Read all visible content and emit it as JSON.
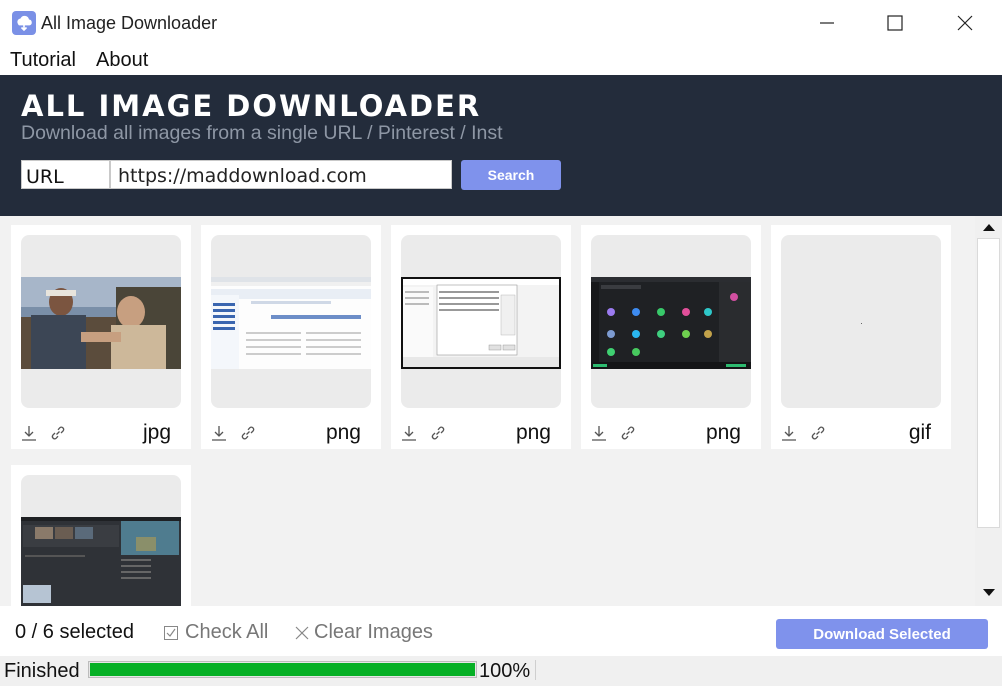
{
  "window": {
    "title": "All Image Downloader"
  },
  "menu": {
    "tutorial": "Tutorial",
    "about": "About"
  },
  "banner": {
    "title": "ALL IMAGE DOWNLOADER",
    "subtitle": "Download all images from a single URL / Pinterest / Inst"
  },
  "search": {
    "type_value": "URL",
    "url_value": "https://maddownload.com",
    "button_label": "Search"
  },
  "images": [
    {
      "ext": "jpg",
      "kind": "photo"
    },
    {
      "ext": "png",
      "kind": "webpage"
    },
    {
      "ext": "png",
      "kind": "dialog"
    },
    {
      "ext": "png",
      "kind": "dark-app"
    },
    {
      "ext": "gif",
      "kind": "blank"
    },
    {
      "ext": "",
      "kind": "editor"
    }
  ],
  "toolbar": {
    "selected_count": "0 / 6 selected",
    "check_all": "Check All",
    "clear_images": "Clear Images",
    "download_selected": "Download Selected"
  },
  "status": {
    "text": "Finished",
    "progress": 1.0,
    "progress_label": "100%"
  },
  "colors": {
    "banner_bg": "#232c3b",
    "accent": "#7f92ec",
    "progress": "#06b025"
  },
  "icons": {
    "app": "cloud-download-icon",
    "minimize": "minimize-icon",
    "maximize": "maximize-icon",
    "close": "close-icon",
    "download": "download-icon",
    "link": "link-icon",
    "check": "checkbox-icon",
    "clear": "x-icon"
  }
}
